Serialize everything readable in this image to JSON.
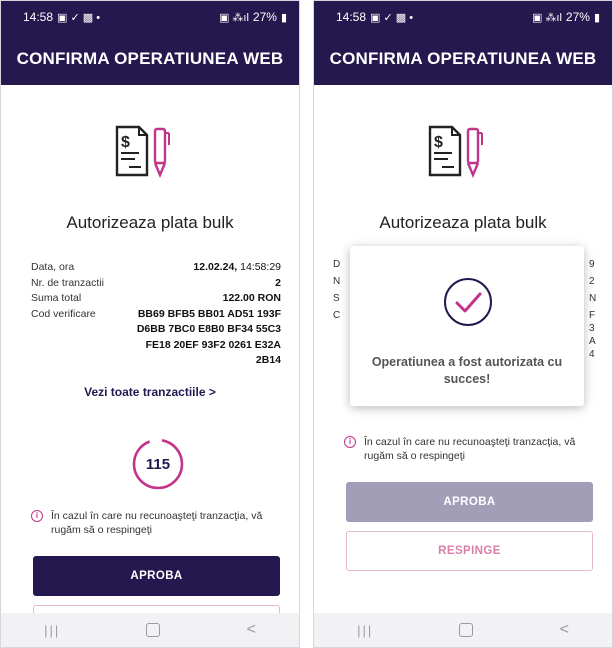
{
  "status_bar": {
    "time": "14:58",
    "battery": "27%"
  },
  "app_bar": {
    "title": "CONFIRMA OPERATIUNEA WEB"
  },
  "screen": {
    "heading": "Autorizeaza plata bulk",
    "details": {
      "date_label": "Data, ora",
      "date_value": "12.02.24,",
      "time_value": "14:58:29",
      "tx_count_label": "Nr. de tranzactii",
      "tx_count_value": "2",
      "total_label": "Suma total",
      "total_value": "122.00 RON",
      "code_label": "Cod verificare",
      "code_lines": [
        "BB69 BFB5 BB01 AD51 193F",
        "D6BB 7BC0 E8B0 BF34 55C3",
        "FE18 20EF 93F2 0261 E32A",
        "2B14"
      ]
    },
    "view_all_link": "Vezi toate tranzactiile",
    "view_all_chevron": ">",
    "timer_value": "115",
    "warning_icon": "i",
    "warning_text": "În cazul în care nu recunoaşteţi tranzacţia, vă rugăm să o respingeţi",
    "approve_button": "APROBA",
    "reject_button": "RESPINGE"
  },
  "modal": {
    "message": "Operatiunea a fost autorizata cu succes!",
    "obscured_row_starts": [
      "D",
      "N",
      "S",
      "C"
    ],
    "obscured_row_ends": [
      "9",
      "2",
      "N",
      "F",
      "3",
      "A",
      "4"
    ]
  },
  "nav": {
    "recents": "|||",
    "back": "<"
  },
  "colors": {
    "brand": "#24184f",
    "accent": "#c2338a",
    "approve_disabled": "#a39eb8",
    "reject_text": "#d880a9"
  },
  "icons": [
    "signal-icon",
    "battery-icon",
    "document-dollar-icon",
    "pen-icon",
    "timer-ring-icon",
    "info-icon",
    "checkmark-circle-icon",
    "recents-icon",
    "home-icon",
    "back-icon"
  ]
}
